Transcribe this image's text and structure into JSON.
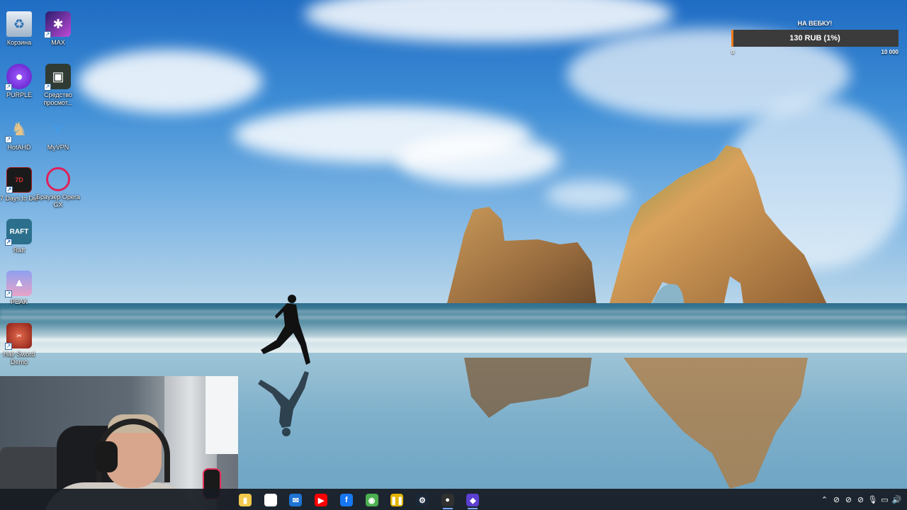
{
  "desktop": {
    "icons": [
      {
        "label": "Корзина",
        "icon": "recycle-bin-icon",
        "color": "#6a8fb3"
      },
      {
        "label": "MAX",
        "icon": "max-app-icon",
        "color": "#3b2a8f"
      },
      {
        "label": "PURPLE",
        "icon": "purple-app-icon",
        "color": "#7a2ee0"
      },
      {
        "label": "Средство просмот...",
        "icon": "photo-viewer-icon",
        "color": "#3d4b3e"
      },
      {
        "label": "HotAHD",
        "icon": "hota-icon",
        "color": "#c49b62"
      },
      {
        "label": "MyVPN",
        "icon": "myvpn-icon",
        "color": "#2c7fd3"
      },
      {
        "label": "7 Days to Die",
        "icon": "7days-icon",
        "color": "#a41a1a"
      },
      {
        "label": "Браузер Opera GX",
        "icon": "opera-gx-icon",
        "color": "#d01848"
      },
      {
        "label": "Raft",
        "icon": "raft-icon",
        "color": "#2b6f8c"
      },
      {
        "label": "PEAK",
        "icon": "peak-icon",
        "color": "#6f6ad6"
      },
      {
        "label": "Hair Sword Demo",
        "icon": "hair-sword-icon",
        "color": "#b23025"
      }
    ]
  },
  "donation": {
    "title": "НА ВЕБКУ!",
    "amount_text": "130 RUB (1%)",
    "progress": 0.013,
    "min_label": "0",
    "max_label": "10 000",
    "fill_color": "#f07a1a"
  },
  "taskbar": {
    "apps": [
      {
        "name": "file-explorer-icon",
        "glyph": "▮",
        "color": "#f2c94c"
      },
      {
        "name": "microsoft-store-icon",
        "glyph": "▦",
        "color": "#ffffff"
      },
      {
        "name": "mail-icon",
        "glyph": "✉",
        "color": "#1f74d4"
      },
      {
        "name": "youtube-icon",
        "glyph": "▶",
        "color": "#ff0000"
      },
      {
        "name": "facebook-icon",
        "glyph": "f",
        "color": "#1877f2"
      },
      {
        "name": "chrome-icon",
        "glyph": "◉",
        "color": "#4caf50"
      },
      {
        "name": "yellow-app-icon",
        "glyph": "❚❚",
        "color": "#e2b400"
      },
      {
        "name": "steam-icon",
        "glyph": "⚙",
        "color": "#1b2838"
      },
      {
        "name": "obs-icon",
        "glyph": "●",
        "color": "#303030"
      },
      {
        "name": "max-taskbar-icon",
        "glyph": "◆",
        "color": "#5b3fd1"
      }
    ],
    "tray": [
      {
        "name": "show-hidden-icons-icon",
        "glyph": "⌃"
      },
      {
        "name": "network-off-icon",
        "glyph": "⊘"
      },
      {
        "name": "wifi-off-icon",
        "glyph": "⊘"
      },
      {
        "name": "battery-off-icon",
        "glyph": "⊘"
      },
      {
        "name": "microphone-icon",
        "glyph": "🎙"
      },
      {
        "name": "display-icon",
        "glyph": "▭"
      },
      {
        "name": "volume-icon",
        "glyph": "🔊"
      }
    ]
  }
}
